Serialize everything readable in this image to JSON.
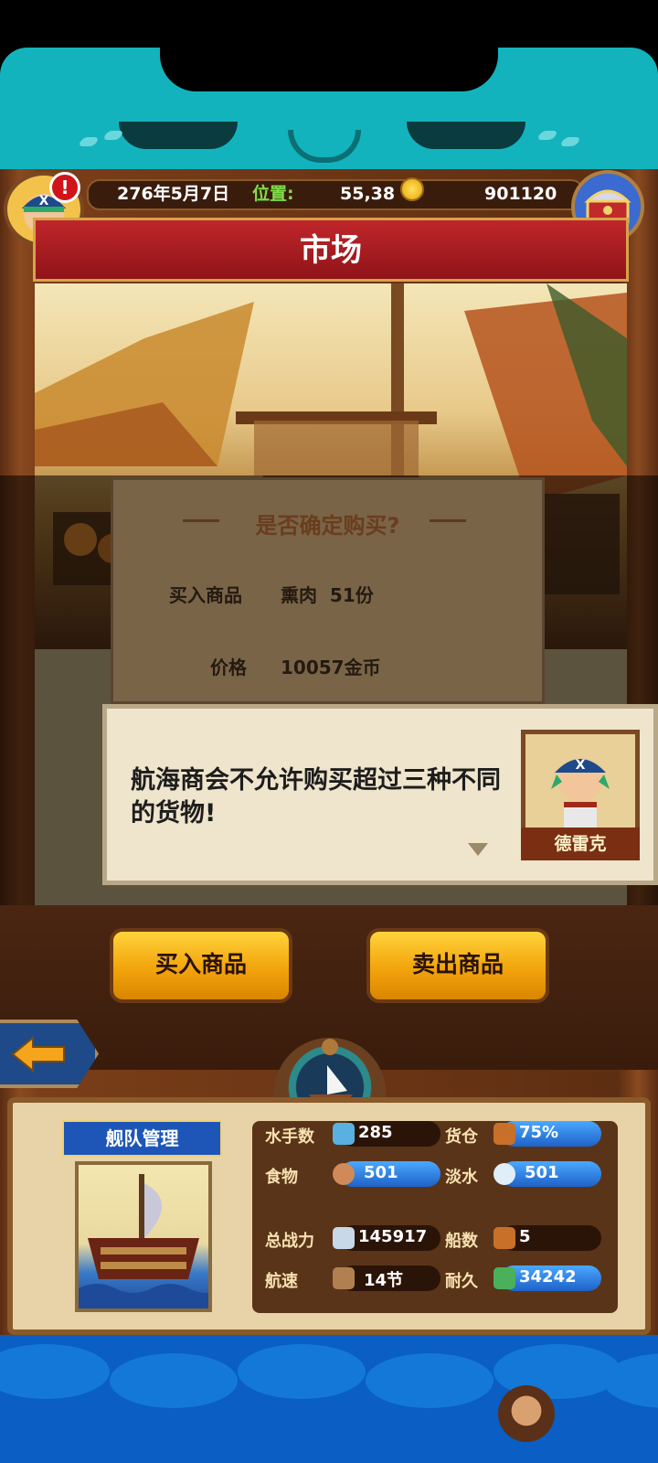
{
  "header": {
    "date": "276年5月7日",
    "position_label": "位置:",
    "position_value": "55,38",
    "gold": "901120"
  },
  "title": "市场",
  "confirm_dialog": {
    "title": "是否确定购买?",
    "item_label": "买入商品",
    "item_value": "熏肉  51份",
    "price_label": "价格",
    "price_value": "10057金币"
  },
  "dialogue": {
    "text": "航海商会不允许购买超过三种不同的货物!",
    "speaker": "德雷克"
  },
  "buttons": {
    "buy": "买入商品",
    "sell": "卖出商品"
  },
  "fleet": {
    "label": "舰队管理",
    "stats": {
      "sailors_label": "水手数",
      "sailors": "285",
      "cargo_label": "货仓",
      "cargo": "75%",
      "food_label": "食物",
      "food": "501",
      "water_label": "淡水",
      "water": "501",
      "power_label": "总战力",
      "power": "145917",
      "ships_label": "船数",
      "ships": "5",
      "speed_label": "航速",
      "speed": "14节",
      "durability_label": "耐久",
      "durability": "34242"
    }
  },
  "colors": {
    "teal": "#13b3bd",
    "banner_red": "#c0262b",
    "button_gold": "#f2a40c",
    "wood": "#7a3e18"
  }
}
